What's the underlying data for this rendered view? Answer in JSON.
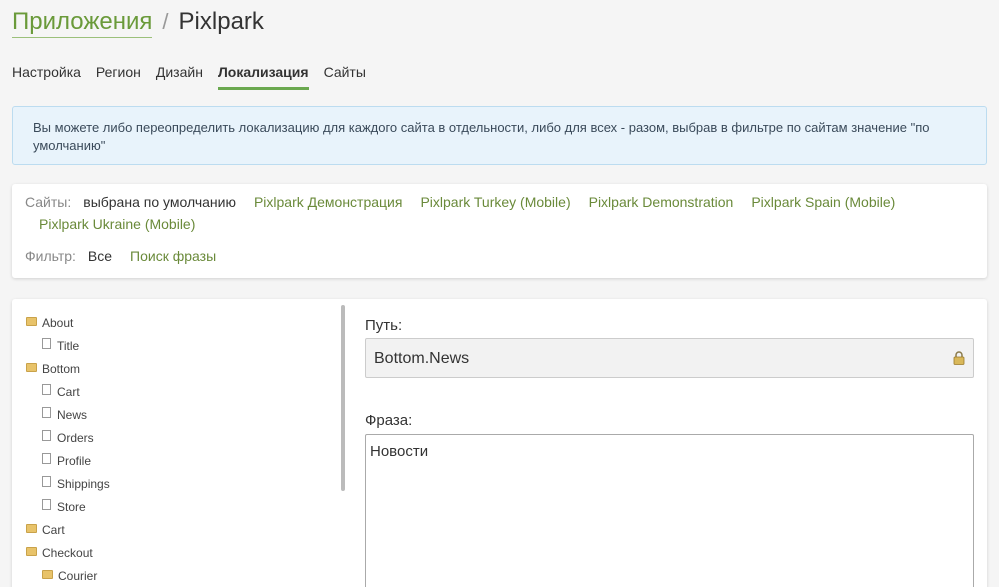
{
  "breadcrumb": {
    "parent": "Приложения",
    "separator": "/",
    "current": "Pixlpark"
  },
  "tabs": [
    {
      "label": "Настройка",
      "active": false
    },
    {
      "label": "Регион",
      "active": false
    },
    {
      "label": "Дизайн",
      "active": false
    },
    {
      "label": "Локализация",
      "active": true
    },
    {
      "label": "Сайты",
      "active": false
    }
  ],
  "info": {
    "text": "Вы можете либо переопределить локализацию для каждого сайта в отдельности, либо для всех - разом, выбрав в фильтре по сайтам значение \"по умолчанию\""
  },
  "filters": {
    "sites_label": "Сайты:",
    "sites_selected": "выбрана по умолчанию",
    "sites": [
      "Pixlpark Демонстрация",
      "Pixlpark Turkey (Mobile)",
      "Pixlpark Demonstration",
      "Pixlpark Spain (Mobile)",
      "Pixlpark Ukraine (Mobile)"
    ],
    "filter_label": "Фильтр:",
    "filter_selected": "Все",
    "filter_link": "Поиск фразы"
  },
  "tree": [
    {
      "label": "About",
      "type": "folder",
      "level": 0
    },
    {
      "label": "Title",
      "type": "file",
      "level": 1
    },
    {
      "label": "Bottom",
      "type": "folder",
      "level": 0
    },
    {
      "label": "Cart",
      "type": "file",
      "level": 1
    },
    {
      "label": "News",
      "type": "file",
      "level": 1
    },
    {
      "label": "Orders",
      "type": "file",
      "level": 1
    },
    {
      "label": "Profile",
      "type": "file",
      "level": 1
    },
    {
      "label": "Shippings",
      "type": "file",
      "level": 1
    },
    {
      "label": "Store",
      "type": "file",
      "level": 1
    },
    {
      "label": "Cart",
      "type": "folder",
      "level": 0
    },
    {
      "label": "Checkout",
      "type": "folder",
      "level": 0
    },
    {
      "label": "Courier",
      "type": "folder",
      "level": 1
    }
  ],
  "editor": {
    "path_label": "Путь:",
    "path_value": "Bottom.News",
    "phrase_label": "Фраза:",
    "phrase_value": "Новости"
  },
  "icons": {
    "folder": "folder-icon",
    "file": "file-icon",
    "lock": "lock-icon"
  }
}
